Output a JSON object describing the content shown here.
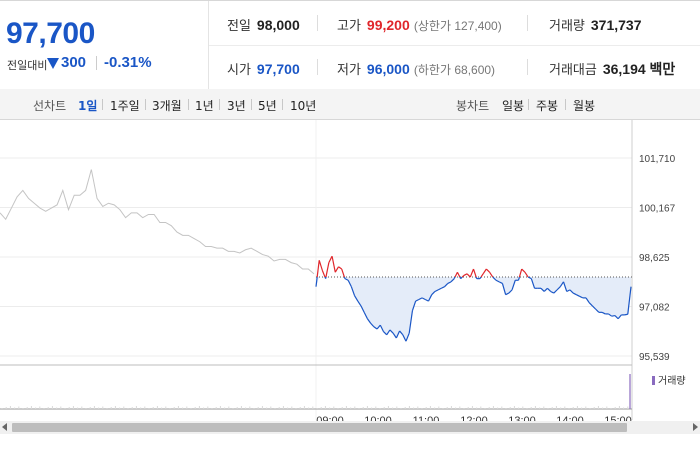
{
  "quote": {
    "price": "97,700",
    "change_label": "전일대비",
    "change_value": "300",
    "change_pct": "-0.31%",
    "direction": "down",
    "down_color": "#1a56c6",
    "up_color": "#e0262b"
  },
  "stats": {
    "prev_close_label": "전일",
    "prev_close": "98,000",
    "high_label": "고가",
    "high": "99,200",
    "upper_limit": "(상한가 127,400)",
    "volume_label": "거래량",
    "volume": "371,737",
    "open_label": "시가",
    "open": "97,700",
    "low_label": "저가",
    "low": "96,000",
    "lower_limit": "(하한가 68,600)",
    "amount_label": "거래대금",
    "amount": "36,194 백만"
  },
  "toolbar": {
    "line_label": "선차트",
    "line_periods": [
      "1일",
      "1주일",
      "3개월",
      "1년",
      "3년",
      "5년",
      "10년"
    ],
    "line_active": "1일",
    "candle_label": "봉차트",
    "candle_periods": [
      "일봉",
      "주봉",
      "월봉"
    ]
  },
  "volume_legend": "거래량",
  "chart_data": {
    "type": "line",
    "y_ticks": [
      "101,710",
      "100,167",
      "98,625",
      "97,082",
      "95,539"
    ],
    "ylim": [
      95539,
      101710
    ],
    "reference": 98000,
    "x_ticks": [
      "09:00",
      "10:00",
      "11:00",
      "12:00",
      "13:00",
      "14:00",
      "15:00"
    ],
    "series": [
      {
        "values": [
          97700,
          98520,
          98200,
          97950,
          98450,
          98650,
          98150,
          98320,
          98250,
          97950,
          97900,
          97700,
          97420,
          97250,
          97100,
          96900,
          96700,
          96560,
          96450,
          96380,
          96500,
          96300,
          96200,
          96350,
          96250,
          96100,
          96320,
          96200,
          96000,
          96250,
          96950,
          97250,
          97300,
          97350,
          97300,
          97250,
          97450,
          97550,
          97600,
          97650,
          97700,
          97800,
          97850,
          97950,
          98150,
          97950,
          98050,
          98100,
          98000,
          98250,
          97950,
          97950,
          98100,
          98250,
          98150,
          98000,
          97900,
          97850,
          97800,
          97450,
          97500,
          97600,
          97900,
          97900,
          98250,
          98150,
          98000,
          97950,
          97650,
          97650,
          97650,
          97550,
          97650,
          97550,
          97500,
          97600,
          97700,
          97850,
          97550,
          97600,
          97500,
          97450,
          97400,
          97350,
          97350,
          97200,
          97100,
          97000,
          96900,
          96900,
          96850,
          96850,
          96780,
          96800,
          96700,
          96820,
          96820,
          96840,
          97700
        ]
      }
    ],
    "prev_day_series": {
      "values": [
        100000,
        99800,
        100150,
        100500,
        100700,
        100450,
        100300,
        100150,
        100050,
        100150,
        100250,
        100700,
        100100,
        100550,
        100550,
        100700,
        101350,
        100450,
        100200,
        100300,
        100250,
        100100,
        99850,
        100000,
        100000,
        99850,
        99950,
        99950,
        99700,
        99700,
        99600,
        99400,
        99300,
        99300,
        99200,
        99100,
        98950,
        98950,
        98900,
        98900,
        98800,
        98800,
        98750,
        98850,
        98900,
        98800,
        98700,
        98650,
        98500,
        98550,
        98550,
        98450,
        98400,
        98250,
        98250,
        98100
      ]
    }
  }
}
